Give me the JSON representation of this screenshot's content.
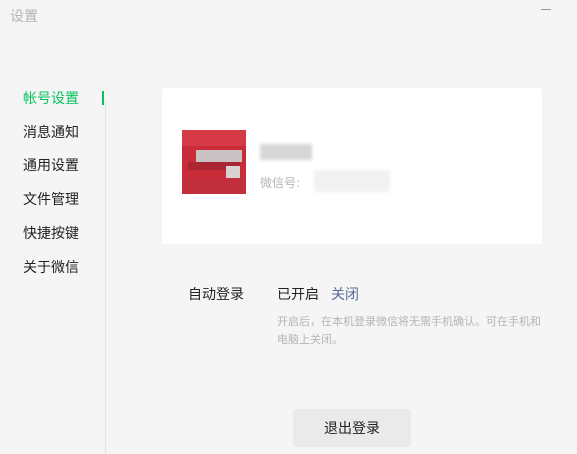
{
  "window": {
    "title": "设置"
  },
  "sidebar": {
    "items": [
      {
        "label": "帐号设置"
      },
      {
        "label": "消息通知"
      },
      {
        "label": "通用设置"
      },
      {
        "label": "文件管理"
      },
      {
        "label": "快捷按键"
      },
      {
        "label": "关于微信"
      }
    ],
    "active_index": 0
  },
  "account": {
    "wechat_id_label": "微信号:"
  },
  "auto_login": {
    "label": "自动登录",
    "status": "已开启",
    "toggle_label": "关闭",
    "description": "开启后，在本机登录微信将无需手机确认。可在手机和电脑上关闭。"
  },
  "logout": {
    "label": "退出登录"
  },
  "colors": {
    "accent": "#07c160",
    "link": "#576b95",
    "background": "#f5f5f5",
    "card": "#ffffff",
    "muted_text": "#b4b4b4"
  }
}
